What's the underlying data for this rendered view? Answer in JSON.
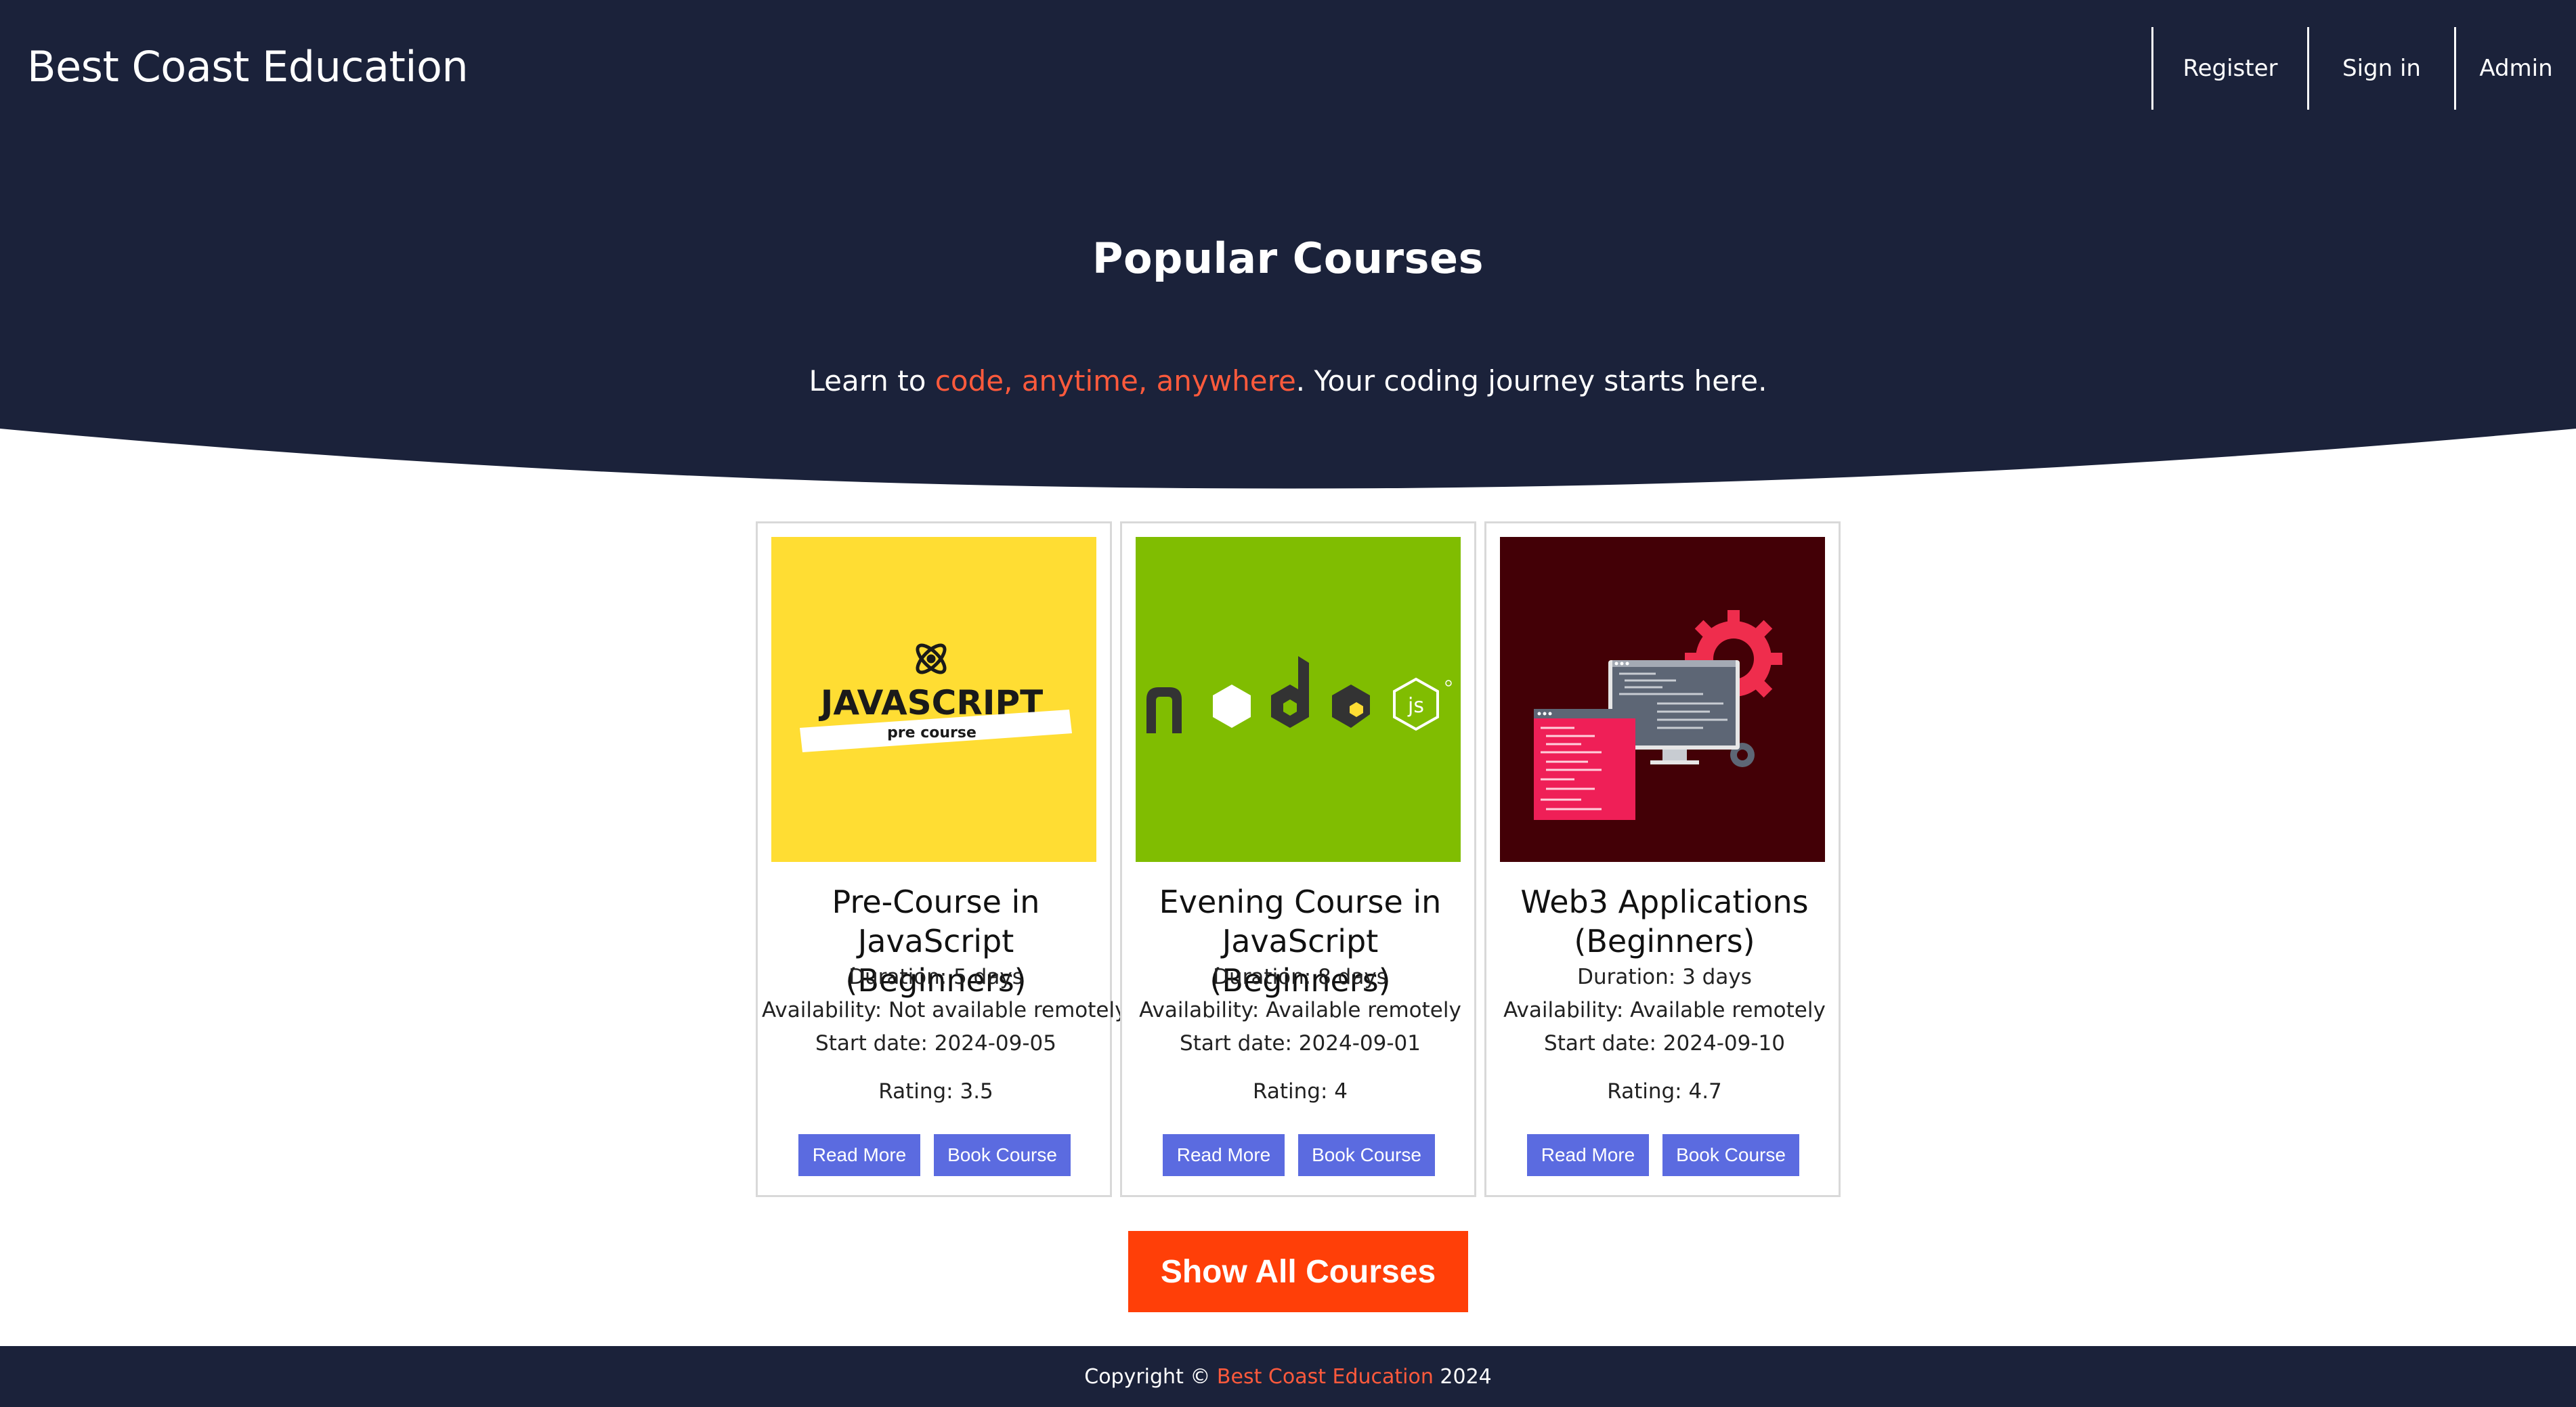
{
  "header": {
    "brand": "Best Coast Education",
    "nav": [
      "Register",
      "Sign in",
      "Admin"
    ]
  },
  "hero": {
    "title": "Popular Courses",
    "subtitle_prefix": "Learn to ",
    "subtitle_highlight": "code, anytime, anywhere",
    "subtitle_suffix": ". Your coding journey starts here."
  },
  "courses": [
    {
      "image": "javascript-pre-course-logo",
      "image_text": [
        "JAVASCRIPT",
        "pre course"
      ],
      "title": "Pre-Course in JavaScript (Beginners)",
      "duration": "Duration: 5 days",
      "availability": "Availability: Not available remotely",
      "start_date": "Start date: 2024-09-05",
      "rating": "Rating: 3.5",
      "read_more": "Read More",
      "book": "Book Course"
    },
    {
      "image": "nodejs-logo",
      "title": "Evening Course in JavaScript (Beginners)",
      "duration": "Duration: 8 days",
      "availability": "Availability: Available remotely",
      "start_date": "Start date: 2024-09-01",
      "rating": "Rating: 4",
      "read_more": "Read More",
      "book": "Book Course"
    },
    {
      "image": "web3-computer-gear-illustration",
      "title": "Web3 Applications (Beginners)",
      "duration": "Duration: 3 days",
      "availability": "Availability: Available remotely",
      "start_date": "Start date: 2024-09-10",
      "rating": "Rating: 4.7",
      "read_more": "Read More",
      "book": "Book Course"
    }
  ],
  "show_all": "Show All Courses",
  "footer": {
    "prefix": "Copyright © ",
    "highlight": "Best Coast Education",
    "suffix": " 2024"
  },
  "colors": {
    "navy": "#1b223a",
    "accent": "#ff5a3c",
    "button": "#5b6be0",
    "cta": "#ff3f08",
    "js_yellow": "#ffdd33",
    "node_green": "#80bd01",
    "web3_maroon": "#430006"
  }
}
